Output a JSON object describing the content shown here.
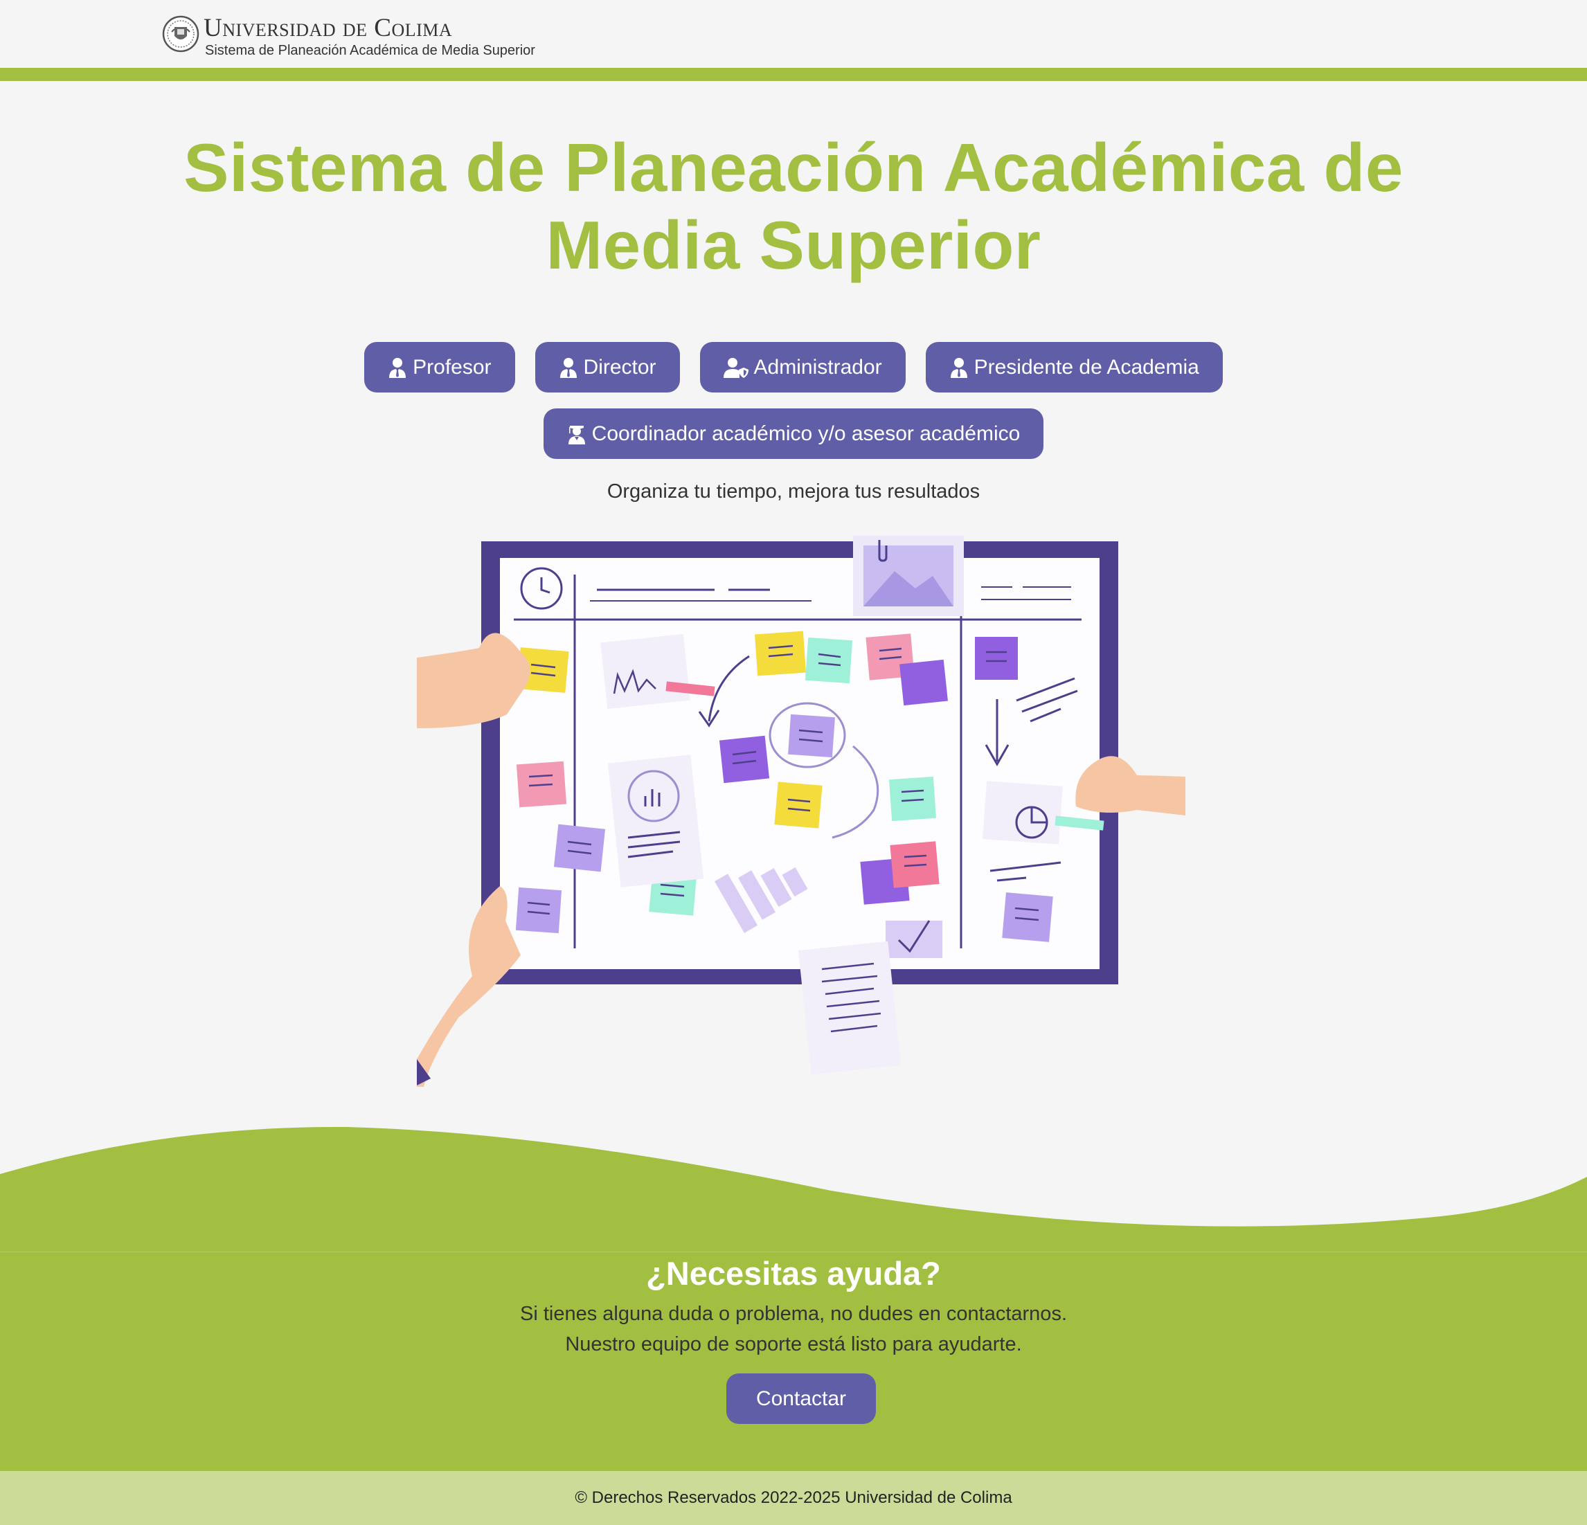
{
  "header": {
    "brand_name": "Universidad de Colima",
    "brand_subtitle": "Sistema de Planeación Académica de Media Superior"
  },
  "hero": {
    "title_line1": "Sistema de Planeación Académica de",
    "title_line2": "Media Superior"
  },
  "roles": {
    "row1": [
      {
        "label": "Profesor",
        "icon": "user-tie-icon"
      },
      {
        "label": "Director",
        "icon": "user-tie-icon"
      },
      {
        "label": "Administrador",
        "icon": "user-shield-icon"
      },
      {
        "label": "Presidente de Academia",
        "icon": "user-tie-icon"
      }
    ],
    "row2": [
      {
        "label": "Coordinador académico y/o asesor académico",
        "icon": "user-graduate-icon"
      }
    ]
  },
  "tagline": "Organiza tu tiempo, mejora tus resultados",
  "help": {
    "title": "¿Necesitas ayuda?",
    "line1": "Si tienes alguna duda o problema, no dudes en contactarnos.",
    "line2": "Nuestro equipo de soporte está listo para ayudarte.",
    "button": "Contactar"
  },
  "footer": {
    "text": "© Derechos Reservados 2022-2025 Universidad de Colima"
  },
  "colors": {
    "accent_green": "#a2bf42",
    "button_purple": "#615ea8",
    "footer_green": "#cbdc98",
    "background": "#f5f5f5"
  }
}
